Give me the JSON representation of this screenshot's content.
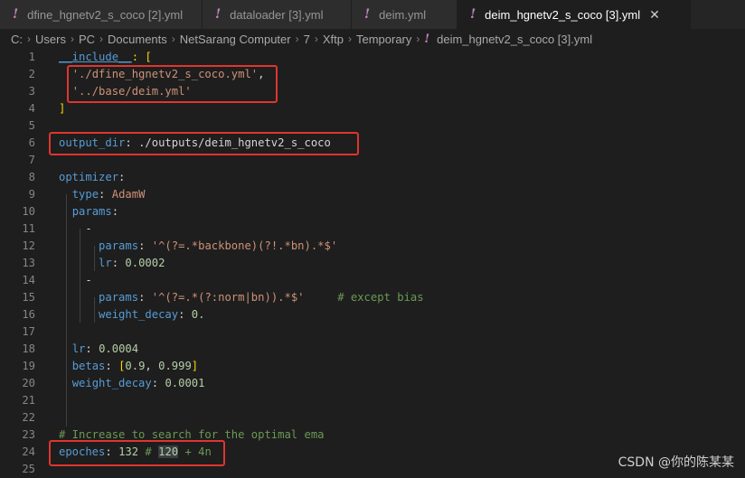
{
  "tabs": [
    {
      "label": "dfine_hgnetv2_s_coco [2].yml",
      "active": false
    },
    {
      "label": "dataloader [3].yml",
      "active": false
    },
    {
      "label": "deim.yml",
      "active": false
    },
    {
      "label": "deim_hgnetv2_s_coco [3].yml",
      "active": true
    }
  ],
  "tab_icon_glyph": "!",
  "close_glyph": "✕",
  "breadcrumb": [
    "C:",
    "Users",
    "PC",
    "Documents",
    "NetSarang Computer",
    "7",
    "Xftp",
    "Temporary"
  ],
  "breadcrumb_file": "deim_hgnetv2_s_coco [3].yml",
  "line_numbers": [
    "1",
    "2",
    "3",
    "4",
    "5",
    "6",
    "7",
    "8",
    "9",
    "10",
    "11",
    "12",
    "13",
    "14",
    "15",
    "16",
    "17",
    "18",
    "19",
    "20",
    "21",
    "22",
    "23",
    "24",
    "25"
  ],
  "code": {
    "l1_key": "__include__",
    "l1_rest": ": [",
    "l2": "'./dfine_hgnetv2_s_coco.yml'",
    "l3": "'../base/deim.yml'",
    "l4": "]",
    "l6_key": "output_dir",
    "l6_val": "./outputs/deim_hgnetv2_s_coco",
    "l8_key": "optimizer",
    "l9_key": "type",
    "l9_val": "AdamW",
    "l10_key": "params",
    "l11_dash": "-",
    "l12_key": "params",
    "l12_val": "'^(?=.*backbone)(?!.*bn).*$'",
    "l13_key": "lr",
    "l13_val": "0.0002",
    "l14_dash": "-",
    "l15_key": "params",
    "l15_val": "'^(?=.*(?:norm|bn)).*$'",
    "l15_comment": "# except bias",
    "l16_key": "weight_decay",
    "l16_val": "0.",
    "l18_key": "lr",
    "l18_val": "0.0004",
    "l19_key": "betas",
    "l19_v1": "0.9",
    "l19_v2": "0.999",
    "l20_key": "weight_decay",
    "l20_val": "0.0001",
    "l23_comment": "# Increase to search for the optimal ema",
    "l24_key": "epoches",
    "l24_val": "132",
    "l24_hash": "#",
    "l24_hl": "120",
    "l24_rest": "+ 4n"
  },
  "watermark": "CSDN @你的陈某某",
  "colors": {
    "keyword": "#569cd6",
    "string": "#ce9178",
    "number": "#b5cea8",
    "comment": "#6a9955",
    "annotation_box": "#e0352f"
  }
}
